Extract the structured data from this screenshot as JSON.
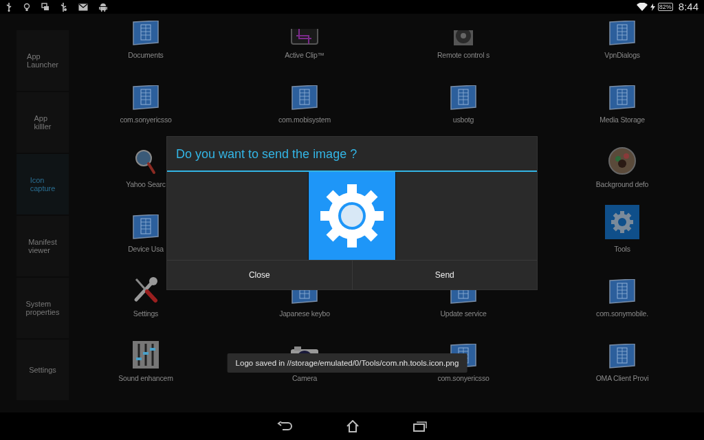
{
  "status_bar": {
    "battery": "82%",
    "time": "8:44"
  },
  "sidebar": {
    "items": [
      {
        "label": "App Launcher",
        "selected": false
      },
      {
        "label": "App killler",
        "selected": false
      },
      {
        "label": "Icon capture",
        "selected": true
      },
      {
        "label": "Manifest viewer",
        "selected": false
      },
      {
        "label": "System properties",
        "selected": false
      },
      {
        "label": "Settings",
        "selected": false
      }
    ]
  },
  "apps": {
    "rows": [
      {
        "items": [
          {
            "label": "Documents",
            "kind": "document"
          },
          {
            "label": "Active Clip™",
            "kind": "clip"
          },
          {
            "label": "Remote control s",
            "kind": "remote"
          },
          {
            "label": "VpnDialogs",
            "kind": "document"
          }
        ]
      },
      {
        "items": [
          {
            "label": "com.sonyericsso",
            "kind": "document"
          },
          {
            "label": "com.mobisystem",
            "kind": "document"
          },
          {
            "label": "usbotg",
            "kind": "document"
          },
          {
            "label": "Media Storage",
            "kind": "document"
          }
        ]
      },
      {
        "items": [
          {
            "label": "Yahoo Searc",
            "kind": "magnifier"
          },
          {
            "label": "Background defo",
            "kind": "round-photo"
          }
        ]
      },
      {
        "items": [
          {
            "label": "Device Usa",
            "kind": "document"
          },
          {
            "label": "Tools",
            "kind": "gear-tile"
          }
        ]
      },
      {
        "items": [
          {
            "label": "Settings",
            "kind": "tools"
          },
          {
            "label": "Japanese keybo",
            "kind": "document"
          },
          {
            "label": "Update service",
            "kind": "document"
          },
          {
            "label": "com.sonymobile.",
            "kind": "document"
          }
        ]
      },
      {
        "items": [
          {
            "label": "Sound enhancem",
            "kind": "sliders"
          },
          {
            "label": "Camera",
            "kind": "camera"
          },
          {
            "label": "com.sonyericsso",
            "kind": "document"
          },
          {
            "label": "OMA Client Provi",
            "kind": "document"
          }
        ]
      }
    ]
  },
  "dialog": {
    "title": "Do you want to send the image ?",
    "buttons": [
      "Close",
      "Send"
    ]
  },
  "toast": {
    "message": "Logo saved in //storage/emulated/0/Tools/com.nh.tools.icon.png"
  }
}
